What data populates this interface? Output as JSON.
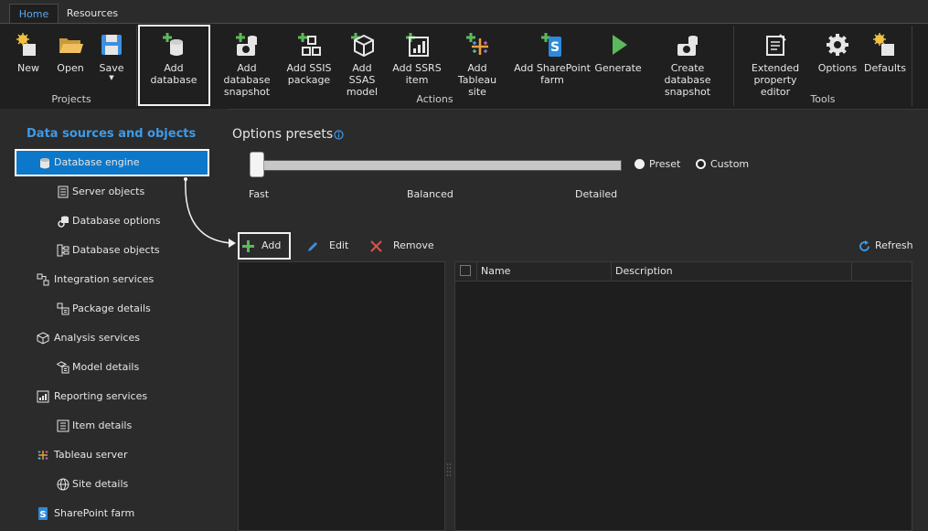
{
  "tabs": {
    "home": "Home",
    "resources": "Resources"
  },
  "ribbon": {
    "projects": {
      "label": "Projects",
      "new": "New",
      "open": "Open",
      "save": "Save"
    },
    "actions": {
      "label": "Actions",
      "add_database": "Add database",
      "add_database_snapshot": [
        "Add database",
        "snapshot"
      ],
      "add_ssis_package": [
        "Add SSIS",
        "package"
      ],
      "add_ssas_model": [
        "Add SSAS",
        "model"
      ],
      "add_ssrs_item": [
        "Add SSRS",
        "item"
      ],
      "add_tableau_site": [
        "Add Tableau",
        "site"
      ],
      "add_sharepoint_farm": [
        "Add SharePoint",
        "farm"
      ],
      "generate": "Generate",
      "create_database_snapshot": [
        "Create database",
        "snapshot"
      ]
    },
    "tools": {
      "label": "Tools",
      "extended_property_editor": [
        "Extended",
        "property editor"
      ],
      "options": "Options",
      "defaults": "Defaults"
    }
  },
  "sidebar": {
    "title": "Data sources and objects",
    "items": [
      {
        "label": "Database engine",
        "icon": "database-icon"
      },
      {
        "label": "Server objects",
        "icon": "server-objects-icon"
      },
      {
        "label": "Database options",
        "icon": "database-options-icon"
      },
      {
        "label": "Database objects",
        "icon": "database-objects-icon"
      },
      {
        "label": "Integration services",
        "icon": "integration-services-icon"
      },
      {
        "label": "Package details",
        "icon": "package-details-icon"
      },
      {
        "label": "Analysis services",
        "icon": "cube-icon"
      },
      {
        "label": "Model details",
        "icon": "model-details-icon"
      },
      {
        "label": "Reporting services",
        "icon": "report-icon"
      },
      {
        "label": "Item details",
        "icon": "item-details-icon"
      },
      {
        "label": "Tableau server",
        "icon": "tableau-icon"
      },
      {
        "label": "Site details",
        "icon": "globe-icon"
      },
      {
        "label": "SharePoint farm",
        "icon": "sharepoint-icon"
      }
    ]
  },
  "options": {
    "title": "Options presets",
    "ticks": [
      "Fast",
      "Balanced",
      "Detailed"
    ],
    "radio_preset": "Preset",
    "radio_custom": "Custom",
    "selected_preset": "Fast"
  },
  "toolbar": {
    "add": "Add",
    "edit": "Edit",
    "remove": "Remove",
    "refresh": "Refresh"
  },
  "grid": {
    "columns": [
      "Name",
      "Description"
    ]
  },
  "colors": {
    "accent": "#0d77c9",
    "title_blue": "#3d9be9",
    "add_green": "#5cb85c",
    "remove_red": "#e05050"
  }
}
